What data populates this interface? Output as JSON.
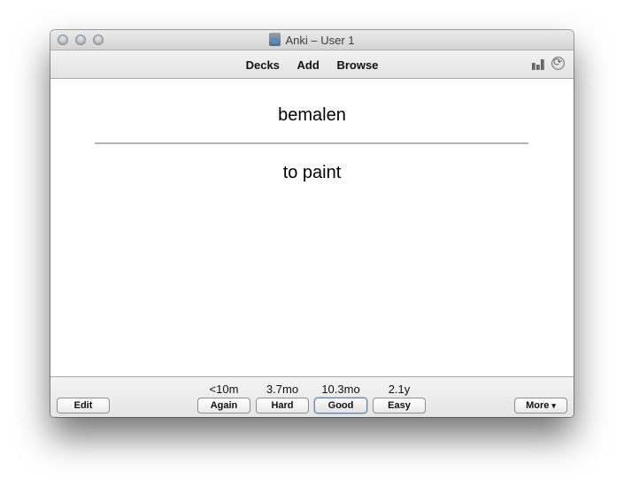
{
  "window": {
    "title": "Anki – User 1",
    "app_icon": "anki-icon"
  },
  "toolbar": {
    "decks": "Decks",
    "add": "Add",
    "browse": "Browse",
    "icons": [
      "stats-icon",
      "sync-icon"
    ]
  },
  "card": {
    "front": "bemalen",
    "back": "to paint"
  },
  "answer_buttons": [
    {
      "label": "Again",
      "interval": "<10m"
    },
    {
      "label": "Hard",
      "interval": "3.7mo"
    },
    {
      "label": "Good",
      "interval": "10.3mo",
      "default": true
    },
    {
      "label": "Easy",
      "interval": "2.1y"
    }
  ],
  "bottom": {
    "edit": "Edit",
    "more": "More",
    "more_arrow": "▾"
  }
}
